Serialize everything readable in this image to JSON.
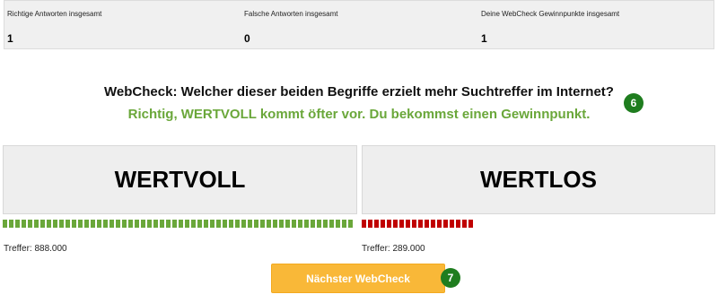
{
  "stats": {
    "correct_label": "Richtige Antworten insgesamt",
    "correct_value": "1",
    "wrong_label": "Falsche Antworten insgesamt",
    "wrong_value": "0",
    "points_label": "Deine WebCheck Gewinnpunkte insgesamt",
    "points_value": "1"
  },
  "question": "WebCheck: Welcher dieser beiden Begriffe erzielt mehr Suchtreffer im Internet?",
  "result": "Richtig, WERTVOLL kommt öfter vor. Du bekommst einen Gewinnpunkt.",
  "markers": {
    "question_marker": "6",
    "button_marker": "7"
  },
  "options": {
    "left": {
      "term": "WERTVOLL",
      "hits_text": "Treffer: 888.000",
      "hits": 888000,
      "bar_color": "#6aa73a"
    },
    "right": {
      "term": "WERTLOS",
      "hits_text": "Treffer: 289.000",
      "hits": 289000,
      "bar_color": "#c00000"
    }
  },
  "next_button": "Nächster WebCheck",
  "colors": {
    "result_text": "#6aa73a",
    "button": "#f9b838",
    "marker": "#1f7d1f"
  }
}
